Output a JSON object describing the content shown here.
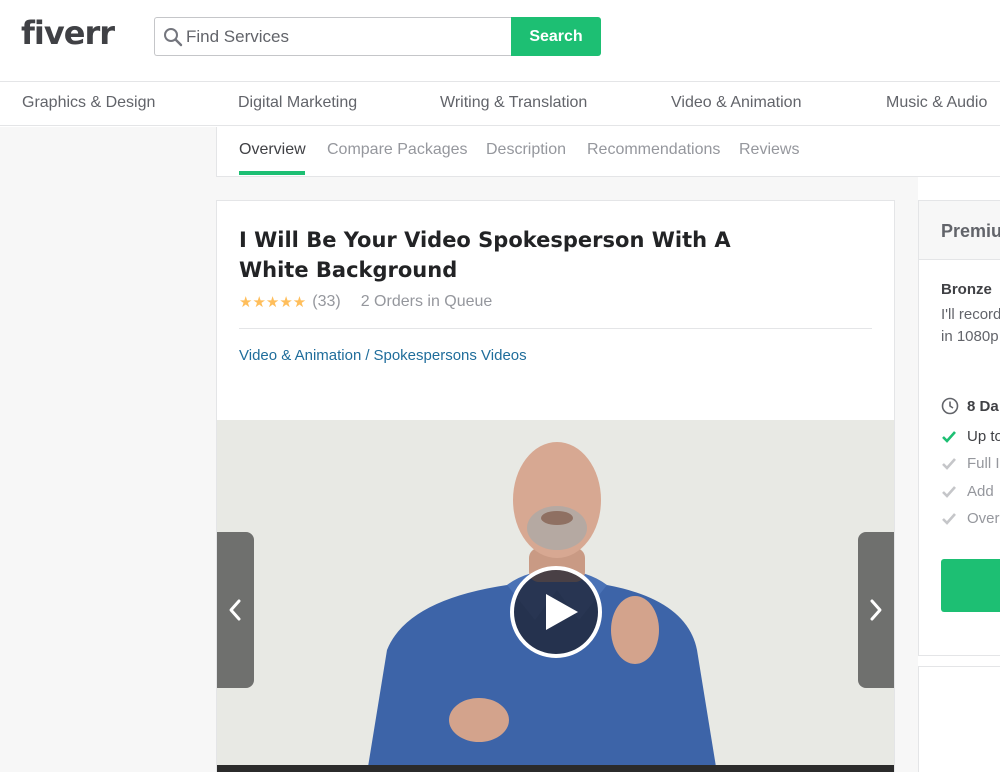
{
  "header": {
    "logo": "fiverr",
    "search_placeholder": "Find Services",
    "search_button": "Search"
  },
  "categories": [
    "Graphics & Design",
    "Digital Marketing",
    "Writing & Translation",
    "Video & Animation",
    "Music & Audio"
  ],
  "tabs": [
    "Overview",
    "Compare Packages",
    "Description",
    "Recommendations",
    "Reviews"
  ],
  "gig": {
    "title": "I Will Be Your Video Spokesperson With A White Background",
    "stars": "★★★★★",
    "rating_count": "(33)",
    "queue": "2 Orders in Queue",
    "breadcrumb": [
      "Video & Animation",
      "Spokespersons Videos"
    ],
    "breadcrumb_sep": "/"
  },
  "package": {
    "tab_label": "Premiu",
    "name": "Bronze",
    "desc_line1": "I'll record",
    "desc_line2": "in 1080p",
    "delivery": "8 Da",
    "features": [
      {
        "label": "Up to",
        "included": true
      },
      {
        "label": "Full I",
        "included": false
      },
      {
        "label": "Add",
        "included": false
      },
      {
        "label": "Over",
        "included": false
      }
    ]
  },
  "colors": {
    "brand_green": "#1dbf73",
    "star": "#ffbe5b",
    "link": "#1f6d9b"
  }
}
